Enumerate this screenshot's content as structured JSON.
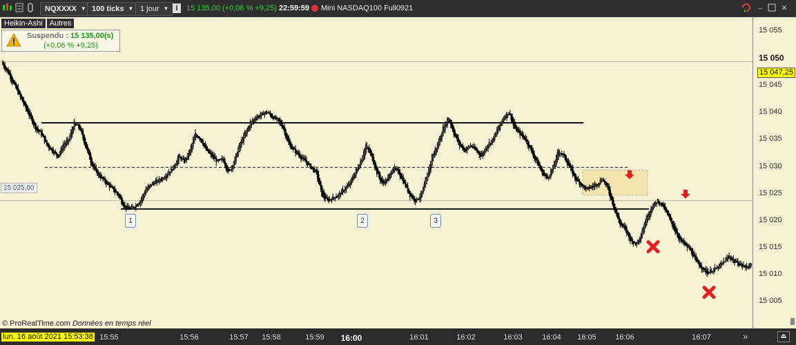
{
  "toolbar": {
    "symbol": "NQXXXX",
    "interval": "100 ticks",
    "period": "1 jour",
    "quote": "15 135,00 (+0,06 % +9,25)",
    "time": "22:59:59",
    "instrument": "Mini NASDAQ100 Full0921"
  },
  "tabs": [
    "Heikin-Ashi",
    "Autres"
  ],
  "alert": {
    "status_label": "Suspendu :",
    "price": "15 135,00(s)",
    "change": "(+0,06 %  +9,25)"
  },
  "left_price_tag": "15 025,00",
  "footer": {
    "brand": "© ProRealTime.com",
    "note": "Données en temps réel"
  },
  "date_box": "lun. 16 août 2021 15:53:38",
  "time_labels": [
    "15:55",
    "15:56",
    "15:57",
    "15:58",
    "15:59",
    "16:00",
    "16:01",
    "16:02",
    "16:03",
    "16:04",
    "16:05",
    "16:06",
    "16:07"
  ],
  "price_labels": [
    "15 055",
    "15 050",
    "15 045",
    "15 040",
    "15 035",
    "15 030",
    "15 025",
    "15 020",
    "15 015",
    "15 010",
    "15 005"
  ],
  "current_price": "15 047,25",
  "markers": [
    "1",
    "2",
    "3"
  ],
  "colors": {
    "chart_bg": "#f6f2d5",
    "bull_candle": "#ffffff",
    "bear_candle": "#000000",
    "price_tag_bg": "#ffff00",
    "signal_red": "#e02020",
    "gain": "#1a9a1a"
  },
  "chart_data": {
    "type": "candlestick",
    "style": "Heikin-Ashi",
    "ylim": [
      15002,
      15058
    ],
    "x_labels": [
      "15:55",
      "15:56",
      "15:57",
      "15:58",
      "15:59",
      "16:00",
      "16:01",
      "16:02",
      "16:03",
      "16:04",
      "16:05",
      "16:06",
      "16:07"
    ],
    "close_path": [
      [
        0,
        15049.5
      ],
      [
        5,
        15048
      ],
      [
        10,
        15046
      ],
      [
        15,
        15044
      ],
      [
        20,
        15042
      ],
      [
        25,
        15040
      ],
      [
        30,
        15038
      ],
      [
        35,
        15037
      ],
      [
        40,
        15035
      ],
      [
        45,
        15034
      ],
      [
        50,
        15033
      ],
      [
        55,
        15035
      ],
      [
        60,
        15036
      ],
      [
        65,
        15039
      ],
      [
        70,
        15038
      ],
      [
        75,
        15035
      ],
      [
        80,
        15032
      ],
      [
        85,
        15030
      ],
      [
        90,
        15029
      ],
      [
        95,
        15028
      ],
      [
        100,
        15027
      ],
      [
        105,
        15026
      ],
      [
        110,
        15024
      ],
      [
        115,
        15023.5
      ],
      [
        120,
        15024
      ],
      [
        125,
        15025
      ],
      [
        130,
        15027
      ],
      [
        135,
        15028
      ],
      [
        140,
        15028.5
      ],
      [
        145,
        15029
      ],
      [
        150,
        15030
      ],
      [
        155,
        15031
      ],
      [
        160,
        15033
      ],
      [
        165,
        15032
      ],
      [
        170,
        15034
      ],
      [
        175,
        15037
      ],
      [
        180,
        15036
      ],
      [
        185,
        15034
      ],
      [
        190,
        15033
      ],
      [
        195,
        15032
      ],
      [
        200,
        15032.5
      ],
      [
        205,
        15030
      ],
      [
        210,
        15032
      ],
      [
        215,
        15035
      ],
      [
        220,
        15037
      ],
      [
        225,
        15039
      ],
      [
        230,
        15040
      ],
      [
        235,
        15040.5
      ],
      [
        240,
        15041
      ],
      [
        245,
        15040
      ],
      [
        250,
        15039.5
      ],
      [
        255,
        15038
      ],
      [
        260,
        15035
      ],
      [
        265,
        15034
      ],
      [
        270,
        15033
      ],
      [
        275,
        15032
      ],
      [
        280,
        15031
      ],
      [
        285,
        15030
      ],
      [
        290,
        15026
      ],
      [
        295,
        15025
      ],
      [
        300,
        15025.5
      ],
      [
        305,
        15026
      ],
      [
        310,
        15027
      ],
      [
        315,
        15028
      ],
      [
        320,
        15030
      ],
      [
        325,
        15032
      ],
      [
        330,
        15035
      ],
      [
        335,
        15033
      ],
      [
        340,
        15030
      ],
      [
        345,
        15028
      ],
      [
        350,
        15029
      ],
      [
        355,
        15031
      ],
      [
        360,
        15030
      ],
      [
        365,
        15028
      ],
      [
        370,
        15026
      ],
      [
        375,
        15025
      ],
      [
        380,
        15026
      ],
      [
        385,
        15029
      ],
      [
        390,
        15033
      ],
      [
        395,
        15035
      ],
      [
        400,
        15038
      ],
      [
        405,
        15040
      ],
      [
        410,
        15037
      ],
      [
        415,
        15035
      ],
      [
        420,
        15034
      ],
      [
        425,
        15035
      ],
      [
        430,
        15034
      ],
      [
        435,
        15033
      ],
      [
        440,
        15035
      ],
      [
        445,
        15036
      ],
      [
        450,
        15038
      ],
      [
        455,
        15040
      ],
      [
        460,
        15041
      ],
      [
        465,
        15038
      ],
      [
        470,
        15037
      ],
      [
        475,
        15036
      ],
      [
        480,
        15034
      ],
      [
        485,
        15032
      ],
      [
        490,
        15030
      ],
      [
        495,
        15029
      ],
      [
        500,
        15031
      ],
      [
        505,
        15034
      ],
      [
        510,
        15033
      ],
      [
        515,
        15031
      ],
      [
        520,
        15029
      ],
      [
        525,
        15028
      ],
      [
        530,
        15027
      ],
      [
        535,
        15027.5
      ],
      [
        540,
        15028
      ],
      [
        545,
        15029
      ],
      [
        550,
        15027
      ],
      [
        555,
        15024
      ],
      [
        560,
        15021
      ],
      [
        565,
        15020
      ],
      [
        570,
        15018
      ],
      [
        575,
        15017
      ],
      [
        580,
        15019
      ],
      [
        585,
        15022
      ],
      [
        590,
        15024
      ],
      [
        595,
        15025
      ],
      [
        600,
        15024
      ],
      [
        605,
        15022
      ],
      [
        610,
        15020
      ],
      [
        615,
        15018
      ],
      [
        620,
        15017
      ],
      [
        625,
        15016
      ],
      [
        630,
        15014
      ],
      [
        635,
        15013
      ],
      [
        640,
        15012
      ],
      [
        645,
        15012.5
      ],
      [
        650,
        15013
      ],
      [
        655,
        15014
      ],
      [
        660,
        15015
      ],
      [
        665,
        15014
      ],
      [
        670,
        15013.5
      ],
      [
        675,
        15013
      ],
      [
        680,
        15013.5
      ]
    ],
    "lines": [
      {
        "kind": "resistance",
        "y": 15039,
        "from": 60,
        "to": 845,
        "style": "solid"
      },
      {
        "kind": "mid",
        "y": 15031,
        "from": 65,
        "to": 910,
        "style": "dashed"
      },
      {
        "kind": "support",
        "y": 15023.5,
        "from": 175,
        "to": 940,
        "style": "solid"
      },
      {
        "kind": "reference",
        "y": 15025,
        "from": 0,
        "to": 1090,
        "style": "thin"
      },
      {
        "kind": "reference",
        "y": 15050,
        "from": 0,
        "to": 1090,
        "style": "thin"
      }
    ],
    "zone": {
      "y_top": 15030.5,
      "y_bottom": 15026
    },
    "signals": [
      {
        "type": "down-arrow",
        "price": 15029.6
      },
      {
        "type": "down-arrow",
        "price": 15026.1
      },
      {
        "type": "cross",
        "price": 15016.7
      },
      {
        "type": "cross",
        "price": 15008.5
      }
    ]
  }
}
